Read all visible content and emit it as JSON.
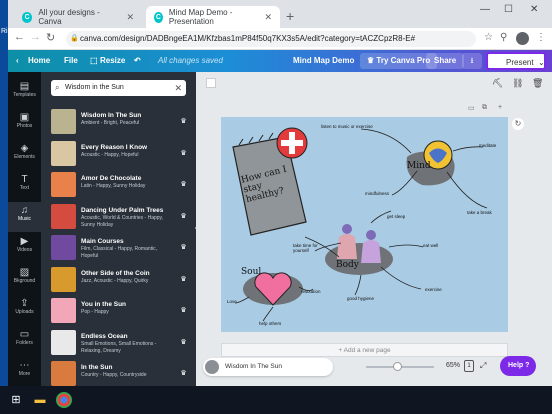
{
  "browser": {
    "tabs": [
      {
        "label": "All your designs - Canva",
        "active": false
      },
      {
        "label": "Mind Map Demo - Presentation",
        "active": true
      }
    ],
    "url": "canva.com/design/DADBngeEA1M/Kfzbas1mP84f50q7KX3s5A/edit?category=tACZCpzR8-E#"
  },
  "canva": {
    "home": "Home",
    "file": "File",
    "resize": "Resize",
    "saved": "All changes saved",
    "design_title": "Mind Map Demo",
    "try_pro": "Try Canva Pro",
    "share": "Share",
    "present": "Present"
  },
  "rail": [
    {
      "label": "Templates",
      "icon": "templates-icon"
    },
    {
      "label": "Photos",
      "icon": "photos-icon"
    },
    {
      "label": "Elements",
      "icon": "elements-icon"
    },
    {
      "label": "Text",
      "icon": "text-icon"
    },
    {
      "label": "Music",
      "icon": "music-icon",
      "active": true
    },
    {
      "label": "Videos",
      "icon": "videos-icon"
    },
    {
      "label": "Bkground",
      "icon": "background-icon"
    },
    {
      "label": "Uploads",
      "icon": "uploads-icon"
    },
    {
      "label": "Folders",
      "icon": "folders-icon"
    },
    {
      "label": "More",
      "icon": "more-icon"
    }
  ],
  "search": {
    "value": "Wisdom in the Sun"
  },
  "tracks": [
    {
      "title": "Wisdom In The Sun",
      "sub": "Ambient - Bright, Peaceful",
      "color": "#b9b38f"
    },
    {
      "title": "Every Reason I Know",
      "sub": "Acoustic - Happy, Hopeful",
      "color": "#d9c6a3"
    },
    {
      "title": "Amor De Chocolate",
      "sub": "Latin - Happy, Sunny Holiday",
      "color": "#e8824a"
    },
    {
      "title": "Dancing Under Palm Trees",
      "sub": "Acoustic, World & Countries - Happy, Sunny Holiday",
      "color": "#d44b3f"
    },
    {
      "title": "Main Courses",
      "sub": "Film, Classical - Happy, Romantic, Hopeful",
      "color": "#6f4a9e"
    },
    {
      "title": "Other Side of the Coin",
      "sub": "Jazz, Acoustic - Happy, Quirky",
      "color": "#d89a2c"
    },
    {
      "title": "You in the Sun",
      "sub": "Pop - Happy",
      "color": "#f2a7b8"
    },
    {
      "title": "Endless Ocean",
      "sub": "Small Emotions, Small Emotions - Relaxing, Dreamy",
      "color": "#e9e9e9"
    },
    {
      "title": "In the Sun",
      "sub": "Country - Happy, Countryside",
      "color": "#d97a3e"
    }
  ],
  "mindmap": {
    "question": "How can I stay healthy?",
    "mind": "Mind",
    "body": "Body",
    "soul": "Soul",
    "labels": [
      "listen to music or exercise",
      "meditate",
      "mindfulness",
      "take a break",
      "get sleep",
      "eat well",
      "take time for yourself",
      "relaxation",
      "good hygiene",
      "exercise",
      "Love",
      "help others"
    ]
  },
  "bottom": {
    "now_playing": "Wisdom In The Sun",
    "add_page": "+ Add a new page",
    "zoom": "65%",
    "zoom_fraction": 0.45,
    "page_count": "1",
    "help": "Help ?"
  }
}
